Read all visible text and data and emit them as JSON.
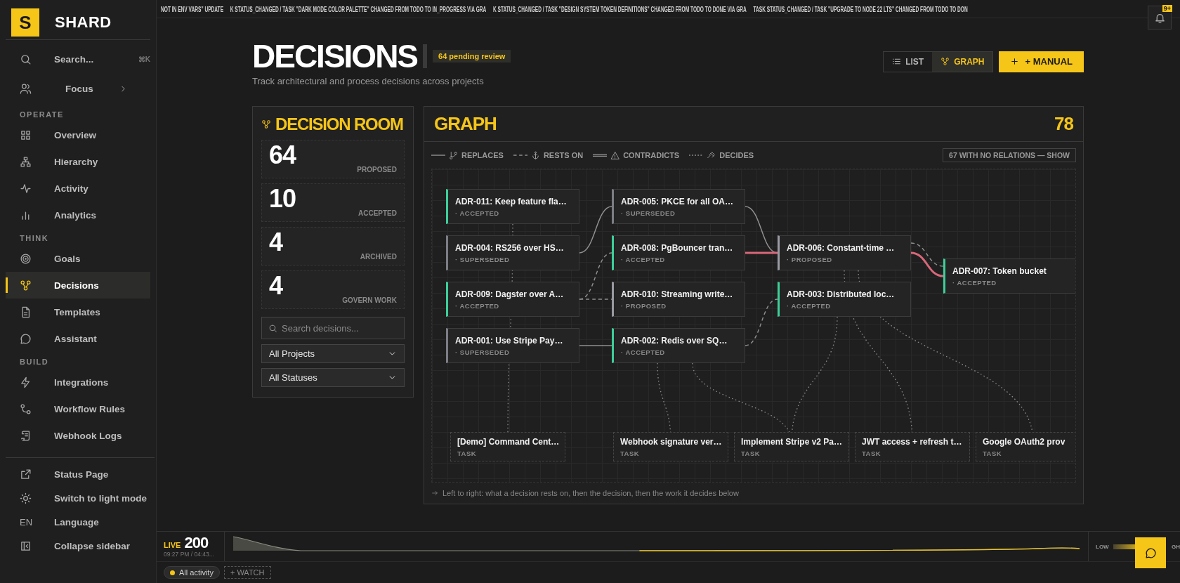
{
  "ticker": [
    "NOT IN ENV VARS\" UPDATE",
    "K STATUS_CHANGED / TASK \"DARK MODE COLOR PALETTE\" CHANGED FROM TODO TO IN_PROGRESS VIA GRA",
    "K STATUS_CHANGED / TASK \"DESIGN SYSTEM TOKEN DEFINITIONS\" CHANGED FROM TODO TO DONE VIA GRA",
    "TASK STATUS_CHANGED / TASK \"UPGRADE TO NODE 22 LTS\" CHANGED FROM TODO TO DON"
  ],
  "notifications": {
    "badge": "9+"
  },
  "sidebar": {
    "brand": {
      "mark": "S",
      "name": "SHARD"
    },
    "search": {
      "label": "Search...",
      "shortcut": "⌘K"
    },
    "focus": {
      "label": "Focus"
    },
    "sections": [
      {
        "title": "OPERATE",
        "items": [
          {
            "label": "Overview",
            "selected": false
          },
          {
            "label": "Hierarchy",
            "selected": false
          },
          {
            "label": "Activity",
            "selected": false
          },
          {
            "label": "Analytics",
            "selected": false
          }
        ]
      },
      {
        "title": "THINK",
        "items": [
          {
            "label": "Goals",
            "selected": false
          },
          {
            "label": "Decisions",
            "selected": true
          },
          {
            "label": "Templates",
            "selected": false
          },
          {
            "label": "Assistant",
            "selected": false
          }
        ]
      },
      {
        "title": "BUILD",
        "items": [
          {
            "label": "Integrations",
            "selected": false
          },
          {
            "label": "Workflow Rules",
            "selected": false
          },
          {
            "label": "Webhook Logs",
            "selected": false
          }
        ]
      }
    ],
    "footer": [
      {
        "label": "Status Page"
      },
      {
        "label": "Switch to light mode"
      },
      {
        "label": "Language",
        "icon_text": "EN"
      },
      {
        "label": "Collapse sidebar"
      }
    ]
  },
  "header": {
    "title": "DECISIONS",
    "badge": "64 pending review",
    "subtitle": "Track architectural and process decisions across projects",
    "views": [
      {
        "label": "LIST",
        "selected": false
      },
      {
        "label": "GRAPH",
        "selected": true
      }
    ],
    "add_button": "+ MANUAL"
  },
  "room": {
    "title": "DECISION ROOM",
    "stats": [
      {
        "value": "64",
        "label": "PROPOSED"
      },
      {
        "value": "10",
        "label": "ACCEPTED"
      },
      {
        "value": "4",
        "label": "ARCHIVED"
      },
      {
        "value": "4",
        "label": "GOVERN WORK"
      }
    ],
    "search": {
      "placeholder": "Search decisions..."
    },
    "filters": [
      "All Projects",
      "All Statuses"
    ]
  },
  "graph": {
    "title": "GRAPH",
    "count": "78",
    "legend": [
      {
        "kind": "replaces",
        "label": "REPLACES"
      },
      {
        "kind": "rests_on",
        "label": "RESTS ON"
      },
      {
        "kind": "contradicts",
        "label": "CONTRADICTS"
      },
      {
        "kind": "decides",
        "label": "DECIDES"
      }
    ],
    "unrelated_button": "67 WITH NO RELATIONS — SHOW",
    "nodes": [
      {
        "kind": "decision",
        "title": "ADR-011: Keep feature fla…",
        "status": "· ACCEPTED",
        "color": "#3ecf9a"
      },
      {
        "kind": "decision",
        "title": "ADR-005: PKCE for all OA…",
        "status": "· SUPERSEDED",
        "color": "#7d7d86"
      },
      {
        "kind": "decision",
        "title": "ADR-004: RS256 over HS…",
        "status": "· SUPERSEDED",
        "color": "#7d7d86"
      },
      {
        "kind": "decision",
        "title": "ADR-008: PgBouncer tran…",
        "status": "· ACCEPTED",
        "color": "#3ecf9a"
      },
      {
        "kind": "decision",
        "title": "ADR-006: Constant-time …",
        "status": "· PROPOSED",
        "color": "#9a9aa3"
      },
      {
        "kind": "decision",
        "title": "ADR-007: Token bucket",
        "status": "· ACCEPTED",
        "color": "#3ecf9a"
      },
      {
        "kind": "decision",
        "title": "ADR-009: Dagster over A…",
        "status": "· ACCEPTED",
        "color": "#3ecf9a"
      },
      {
        "kind": "decision",
        "title": "ADR-010: Streaming write…",
        "status": "· PROPOSED",
        "color": "#9a9aa3"
      },
      {
        "kind": "decision",
        "title": "ADR-003: Distributed loc…",
        "status": "· ACCEPTED",
        "color": "#3ecf9a"
      },
      {
        "kind": "decision",
        "title": "ADR-001: Use Stripe Pay…",
        "status": "· SUPERSEDED",
        "color": "#7d7d86"
      },
      {
        "kind": "decision",
        "title": "ADR-002: Redis over SQ…",
        "status": "· ACCEPTED",
        "color": "#3ecf9a"
      },
      {
        "kind": "task",
        "title": "[Demo] Command Cent…",
        "status": "TASK"
      },
      {
        "kind": "task",
        "title": "Webhook signature ver…",
        "status": "TASK"
      },
      {
        "kind": "task",
        "title": "Implement Stripe v2 Pa…",
        "status": "TASK"
      },
      {
        "kind": "task",
        "title": "JWT access + refresh t…",
        "status": "TASK"
      },
      {
        "kind": "task",
        "title": "Google OAuth2 prov",
        "status": "TASK"
      }
    ],
    "note": "Left to right: what a decision rests on, then the decision, then the work it decides below"
  },
  "live": {
    "label": "LIVE",
    "count": "200",
    "time": "09:27 PM / 04:43...",
    "scale_low": "LOW",
    "scale_high": "GH"
  },
  "activity_filter": {
    "label": "All activity",
    "selected": true
  },
  "watch_button": "+ WATCH"
}
